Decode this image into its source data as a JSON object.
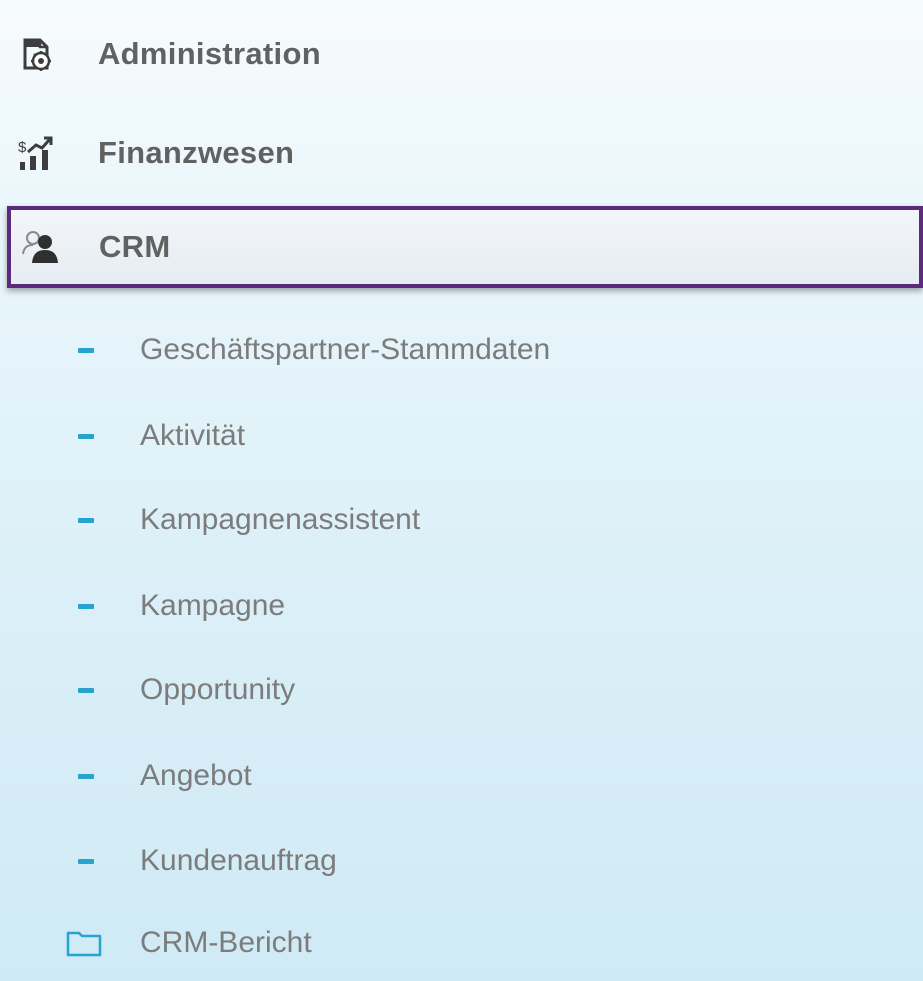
{
  "menu": {
    "top_items": [
      {
        "label": "Administration",
        "icon": "admin-doc-gear-icon"
      },
      {
        "label": "Finanzwesen",
        "icon": "finance-chart-icon"
      },
      {
        "label": "CRM",
        "icon": "people-icon",
        "selected": true
      }
    ],
    "crm_sub_items": [
      {
        "label": "Geschäftspartner-Stammdaten"
      },
      {
        "label": "Aktivität"
      },
      {
        "label": "Kampagnenassistent"
      },
      {
        "label": "Kampagne"
      },
      {
        "label": "Opportunity"
      },
      {
        "label": "Angebot"
      },
      {
        "label": "Kundenauftrag"
      }
    ],
    "folder_item": {
      "label": "CRM-Bericht",
      "icon": "folder-icon"
    }
  },
  "colors": {
    "selected_border": "#5b2a7c",
    "dash_accent": "#27a3cf",
    "top_label": "#616161",
    "sub_label": "#7c7c7c"
  }
}
